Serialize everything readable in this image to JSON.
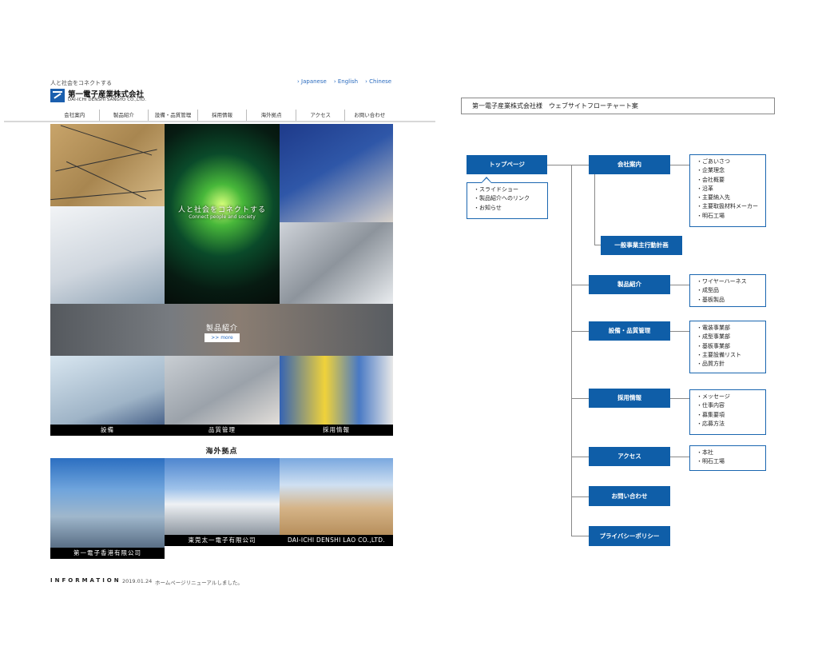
{
  "site": {
    "tagline": "人と社会をコネクトする",
    "logo": {
      "name_jp": "第一電子産業株式会社",
      "name_en": "DAI-ICHI DENSHI SANGYO CO.,LTD.",
      "mark_text": "DAIICHI"
    },
    "languages": [
      "› Japanese",
      "› English",
      "› Chinese"
    ],
    "nav": [
      "会社案内",
      "製品紹介",
      "設備・品質管理",
      "採用情報",
      "海外拠点",
      "アクセス",
      "お問い合わせ"
    ],
    "hero": {
      "title": "人と社会をコネクトする",
      "subtitle": "Connect people and society"
    },
    "products": {
      "title": "製品紹介",
      "more": ">> more"
    },
    "captions": [
      "設備",
      "品質管理",
      "採用情報"
    ],
    "overseas": {
      "title": "海外拠点",
      "captions": [
        "第一電子香港有限公司",
        "東莞太一電子有限公司",
        "DAI-ICHI DENSHI LAO CO.,LTD."
      ]
    },
    "information": {
      "label": "INFORMATION",
      "date": "2019.01.24",
      "text": "ホームページリニューアルしました。"
    }
  },
  "flowchart": {
    "title": "第一電子産業株式会社様　ウェブサイトフローチャート案",
    "top": {
      "label": "トップページ",
      "items": [
        "スライドショー",
        "製品紹介へのリンク",
        "お知らせ"
      ]
    },
    "sections": [
      {
        "label": "会社案内",
        "items": [
          "ごあいさつ",
          "企業理念",
          "会社概要",
          "沿革",
          "主要納入先",
          "主要取扱材料メーカー",
          "明石工場"
        ]
      },
      {
        "label": "一般事業主行動計画",
        "items": []
      },
      {
        "label": "製品紹介",
        "items": [
          "ワイヤーハーネス",
          "成型品",
          "基板製品"
        ]
      },
      {
        "label": "設備・品質管理",
        "items": [
          "電装事業部",
          "成型事業部",
          "基板事業部",
          "主要設備リスト",
          "品質方針"
        ]
      },
      {
        "label": "採用情報",
        "items": [
          "メッセージ",
          "仕事内容",
          "募集要項",
          "応募方法"
        ]
      },
      {
        "label": "アクセス",
        "items": [
          "本社",
          "明石工場"
        ]
      },
      {
        "label": "お問い合わせ",
        "items": []
      },
      {
        "label": "プライバシーポリシー",
        "items": []
      }
    ],
    "colors": {
      "box": "#0f5ea8",
      "list_border": "#1a66b0",
      "connector": "#888888"
    }
  }
}
